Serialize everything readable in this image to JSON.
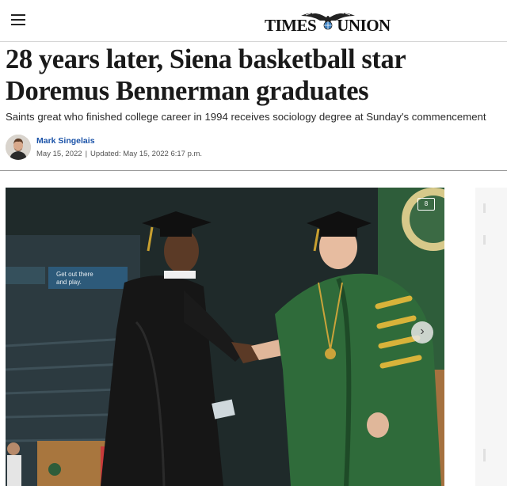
{
  "header": {
    "logo_left": "TIMES",
    "logo_right": "UNION"
  },
  "article": {
    "headline": "28 years later, Siena basketball star Doremus Bennerman graduates",
    "subheadline": "Saints great who finished college career in 1994 receives sociology degree at Sunday's commencement",
    "author": "Mark Singelais",
    "published": "May 15, 2022",
    "updated": "Updated: May 15, 2022 6:17 p.m."
  },
  "photo": {
    "banner_text": "Get out there and play.",
    "gallery_count": "8"
  },
  "colors": {
    "link": "#1b53a8",
    "robe_green": "#2f6b3a",
    "stole_gold": "#d8b33a"
  },
  "icons": [
    "menu-icon",
    "gallery-icon",
    "chevron-right-icon"
  ]
}
